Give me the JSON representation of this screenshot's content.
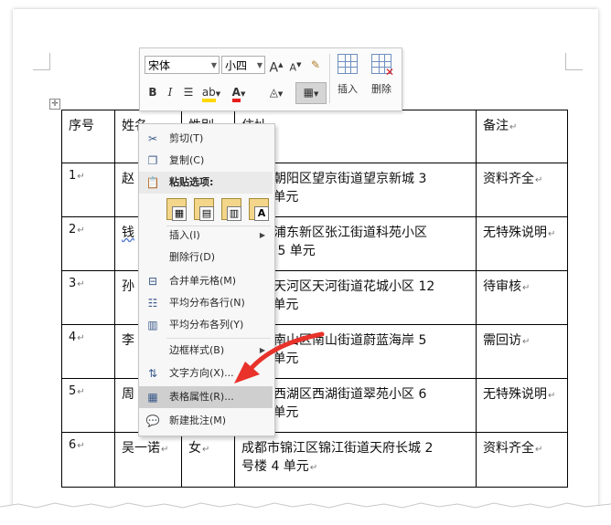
{
  "toolbar": {
    "font_name": "宋体",
    "font_size": "小四",
    "insert_label": "插入",
    "delete_label": "删除",
    "bold": "B",
    "italic": "I",
    "grow": "A",
    "shrink": "A"
  },
  "table": {
    "headers": [
      "序号",
      "姓名",
      "性别",
      "住址",
      "备注"
    ],
    "rows": [
      {
        "num": "1",
        "name": "赵",
        "gender": "",
        "addr1": "市朝阳区望京街道望京新城 3",
        "addr2": "2 单元",
        "note": "资料齐全"
      },
      {
        "num": "2",
        "name": "钱",
        "gender": "",
        "addr1": "市浦东新区张江街道科苑小区",
        "addr2": "楼 5 单元",
        "note": "无特殊说明"
      },
      {
        "num": "3",
        "name": "孙",
        "gender": "",
        "addr1": "市天河区天河街道花城小区 12",
        "addr2": "1 单元",
        "note": "待审核"
      },
      {
        "num": "4",
        "name": "李",
        "gender": "",
        "addr1": "市南山区南山街道蔚蓝海岸 5",
        "addr2": "3 单元",
        "note": "需回访"
      },
      {
        "num": "5",
        "name": "周",
        "gender": "",
        "addr1": "市西湖区西湖街道翠苑小区 6",
        "addr2": "1 单元",
        "note": "无特殊说明"
      },
      {
        "num": "6",
        "name": "吴一诺",
        "gender": "女",
        "addr1": "成都市锦江区锦江街道天府长城 2",
        "addr2": "号楼 4 单元",
        "note": "资料齐全"
      }
    ]
  },
  "context_menu": {
    "cut": "剪切(T)",
    "copy": "复制(C)",
    "paste_options": "粘贴选项:",
    "insert": "插入(I)",
    "delete_row": "删除行(D)",
    "merge_cells": "合并单元格(M)",
    "distribute_rows": "平均分布各行(N)",
    "distribute_cols": "平均分布各列(Y)",
    "border_style": "边框样式(B)",
    "text_direction": "文字方向(X)...",
    "table_properties": "表格属性(R)...",
    "new_comment": "新建批注(M)"
  },
  "colors": {
    "highlight_yellow": "#ffd800",
    "font_red": "#e81c1c",
    "arrow_red": "#e8322a",
    "menu_highlight": "#cfcfcf"
  }
}
